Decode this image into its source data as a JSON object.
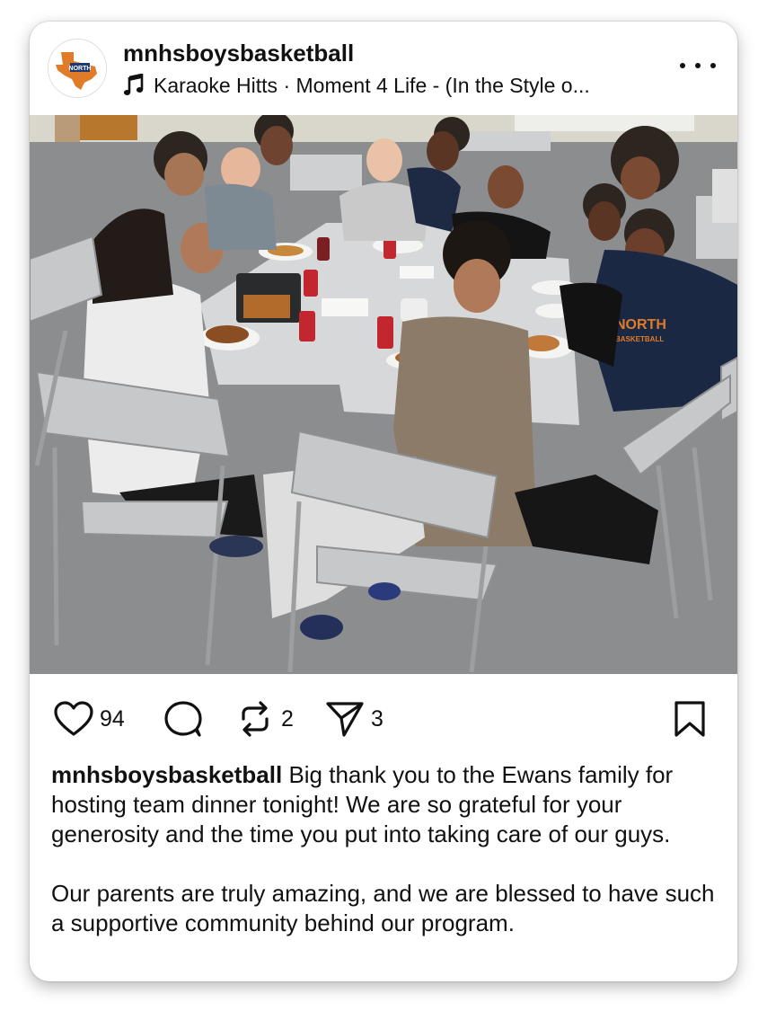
{
  "post": {
    "username": "mnhsboysbasketball",
    "avatar_text": "NORTH",
    "audio": {
      "icon": "music-note-icon",
      "label": "Karaoke Hitts · Moment 4 Life - (In the Style o..."
    },
    "more_icon": "more-horizontal-icon",
    "photo_icon": "volume-icon",
    "jersey_text": "NORTH",
    "jersey_subtext": "BASKETBALL"
  },
  "actions": {
    "like_icon": "heart-icon",
    "likes": "94",
    "comment_icon": "comment-icon",
    "repost_icon": "repost-icon",
    "reposts": "2",
    "share_icon": "send-icon",
    "shares": "3",
    "save_icon": "bookmark-icon"
  },
  "caption": {
    "username": "mnhsboysbasketball",
    "paragraph1": "Big thank you to the Ewans family for hosting team dinner tonight! We are so grateful for your generosity and the time you put into taking care of our guys.",
    "paragraph2": "Our parents are truly amazing, and we are blessed to have such a supportive community behind our program."
  },
  "colors": {
    "text": "#111111",
    "logo_orange": "#e07b28",
    "logo_navy": "#1f3a6e",
    "photo_floor": "#8d8f91",
    "table": "#d9dadb"
  }
}
